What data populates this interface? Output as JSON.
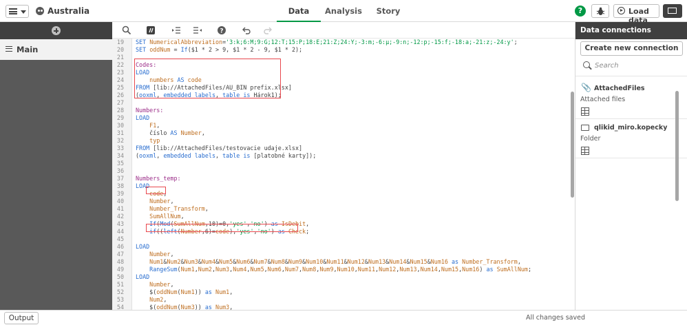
{
  "header": {
    "app_name": "Australia",
    "tabs": [
      {
        "label": "Data",
        "active": true
      },
      {
        "label": "Analysis",
        "active": false
      },
      {
        "label": "Story",
        "active": false
      }
    ],
    "help_label": "?",
    "load_label": "Load data",
    "accent_color": "#009845"
  },
  "sidebar": {
    "items": [
      {
        "label": "Main"
      }
    ]
  },
  "editor": {
    "lines": [
      {
        "n": "19",
        "code": "SET NumericalAbbreviation='3:k;6:M;9:G;12:T;15:P;18:E;21:Z;24:Y;-3:m;-6:μ;-9:n;-12:p;-15:f;-18:a;-21:z;-24:y';"
      },
      {
        "n": "20",
        "code": "SET oddNum = If($1 * 2 > 9, $1 * 2 - 9, $1 * 2);"
      },
      {
        "n": "21",
        "code": ""
      },
      {
        "n": "22",
        "code": "Codes:"
      },
      {
        "n": "23",
        "code": "LOAD"
      },
      {
        "n": "24",
        "code": "    numbers AS code"
      },
      {
        "n": "25",
        "code": "FROM [lib://AttachedFiles/AU_BIN prefix.xlsx]"
      },
      {
        "n": "26",
        "code": "(ooxml, embedded labels, table is Hárok1);"
      },
      {
        "n": "27",
        "code": ""
      },
      {
        "n": "28",
        "code": "Numbers:"
      },
      {
        "n": "29",
        "code": "LOAD"
      },
      {
        "n": "30",
        "code": "    F1,"
      },
      {
        "n": "31",
        "code": "    číslo AS Number,"
      },
      {
        "n": "32",
        "code": "    typ"
      },
      {
        "n": "33",
        "code": "FROM [lib://AttachedFiles/testovacie udaje.xlsx]"
      },
      {
        "n": "34",
        "code": "(ooxml, embedded labels, table is [platobné karty]);"
      },
      {
        "n": "35",
        "code": ""
      },
      {
        "n": "36",
        "code": ""
      },
      {
        "n": "37",
        "code": "Numbers_temp:"
      },
      {
        "n": "38",
        "code": "LOAD"
      },
      {
        "n": "39",
        "code": "    code,"
      },
      {
        "n": "40",
        "code": "    Number,"
      },
      {
        "n": "41",
        "code": "    Number_Transform,"
      },
      {
        "n": "42",
        "code": "    SumAllNum,"
      },
      {
        "n": "43",
        "code": "    If(Mod(SumAllNum,10)=0,'yes','no') as IsDebit,"
      },
      {
        "n": "44",
        "code": "    if((left(Number,6)=code),'yes','no') as Check;"
      },
      {
        "n": "45",
        "code": ""
      },
      {
        "n": "46",
        "code": "LOAD"
      },
      {
        "n": "47",
        "code": "    Number,"
      },
      {
        "n": "48",
        "code": "    Num1&Num2&Num3&Num4&Num5&Num6&Num7&Num8&Num9&Num10&Num11&Num12&Num13&Num14&Num15&Num16 as Number_Transform,"
      },
      {
        "n": "49",
        "code": "    RangeSum(Num1,Num2,Num3,Num4,Num5,Num6,Num7,Num8,Num9,Num10,Num11,Num12,Num13,Num14,Num15,Num16) as SumAllNum;"
      },
      {
        "n": "50",
        "code": "LOAD"
      },
      {
        "n": "51",
        "code": "    Number,"
      },
      {
        "n": "52",
        "code": "    $(oddNum(Num1)) as Num1,"
      },
      {
        "n": "53",
        "code": "    Num2,"
      },
      {
        "n": "54",
        "code": "    $(oddNum(Num3)) as Num3,"
      }
    ]
  },
  "connections": {
    "title": "Data connections",
    "create_label": "Create new connection",
    "search_placeholder": "Search",
    "items": [
      {
        "name": "AttachedFiles",
        "sub": "Attached files"
      },
      {
        "name": "qlikid_miro.kopecky",
        "sub": "Folder"
      }
    ]
  },
  "footer": {
    "output_label": "Output",
    "status": "All changes saved"
  }
}
